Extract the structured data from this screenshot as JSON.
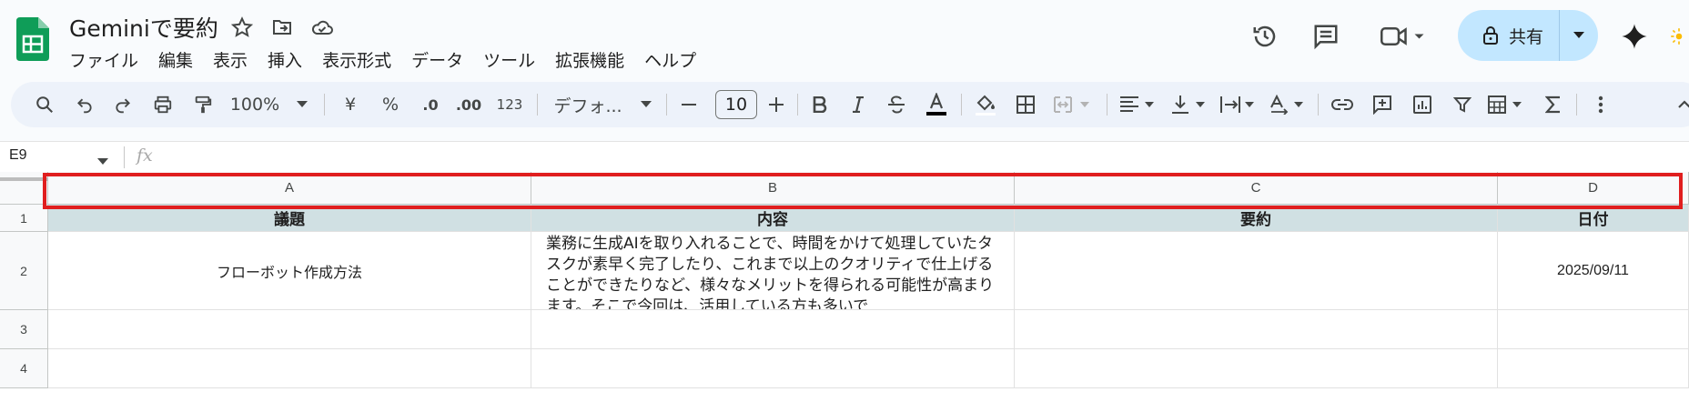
{
  "app": {
    "title": "Geminiで要約",
    "menu": [
      "ファイル",
      "編集",
      "表示",
      "挿入",
      "表示形式",
      "データ",
      "ツール",
      "拡張機能",
      "ヘルプ"
    ],
    "share_label": "共有",
    "accent": "#c2e7ff"
  },
  "toolbar": {
    "zoom": "100%",
    "currency": "¥",
    "percent": "%",
    "dec_decrease": ".0",
    "dec_increase": ".00",
    "number_format": "123",
    "font": "デフォ...",
    "font_size": "10"
  },
  "formula_bar": {
    "name_box": "E9",
    "fx": "fx",
    "content": ""
  },
  "sheet": {
    "columns": [
      "A",
      "B",
      "C",
      "D"
    ],
    "rows": [
      "1",
      "2",
      "3",
      "4"
    ],
    "header_fill": "#d0e0e3",
    "header_row": [
      "議題",
      "内容",
      "要約",
      "日付"
    ],
    "row2": {
      "a": "フローボット作成方法",
      "b": "業務に生成AIを取り入れることで、時間をかけて処理していたタスクが素早く完了したり、これまで以上のクオリティで仕上げることができたりなど、様々なメリットを得られる可能性が高まります。そこで今回は、活用している方も多いで",
      "c": "",
      "d": "2025/09/11"
    },
    "highlight_color": "#e01e1e"
  }
}
